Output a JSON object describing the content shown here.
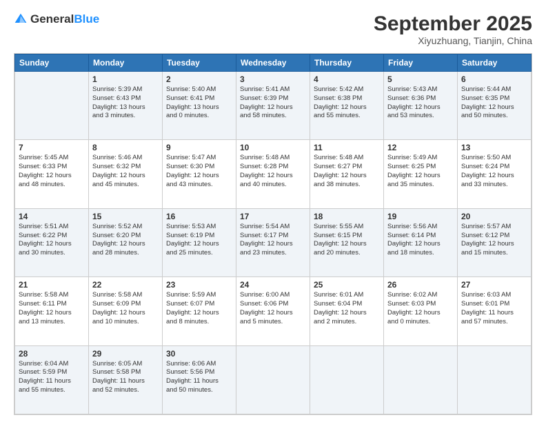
{
  "header": {
    "logo_general": "General",
    "logo_blue": "Blue",
    "month_title": "September 2025",
    "location": "Xiyuzhuang, Tianjin, China"
  },
  "weekdays": [
    "Sunday",
    "Monday",
    "Tuesday",
    "Wednesday",
    "Thursday",
    "Friday",
    "Saturday"
  ],
  "weeks": [
    [
      {
        "day": "",
        "info": ""
      },
      {
        "day": "1",
        "info": "Sunrise: 5:39 AM\nSunset: 6:43 PM\nDaylight: 13 hours\nand 3 minutes."
      },
      {
        "day": "2",
        "info": "Sunrise: 5:40 AM\nSunset: 6:41 PM\nDaylight: 13 hours\nand 0 minutes."
      },
      {
        "day": "3",
        "info": "Sunrise: 5:41 AM\nSunset: 6:39 PM\nDaylight: 12 hours\nand 58 minutes."
      },
      {
        "day": "4",
        "info": "Sunrise: 5:42 AM\nSunset: 6:38 PM\nDaylight: 12 hours\nand 55 minutes."
      },
      {
        "day": "5",
        "info": "Sunrise: 5:43 AM\nSunset: 6:36 PM\nDaylight: 12 hours\nand 53 minutes."
      },
      {
        "day": "6",
        "info": "Sunrise: 5:44 AM\nSunset: 6:35 PM\nDaylight: 12 hours\nand 50 minutes."
      }
    ],
    [
      {
        "day": "7",
        "info": "Sunrise: 5:45 AM\nSunset: 6:33 PM\nDaylight: 12 hours\nand 48 minutes."
      },
      {
        "day": "8",
        "info": "Sunrise: 5:46 AM\nSunset: 6:32 PM\nDaylight: 12 hours\nand 45 minutes."
      },
      {
        "day": "9",
        "info": "Sunrise: 5:47 AM\nSunset: 6:30 PM\nDaylight: 12 hours\nand 43 minutes."
      },
      {
        "day": "10",
        "info": "Sunrise: 5:48 AM\nSunset: 6:28 PM\nDaylight: 12 hours\nand 40 minutes."
      },
      {
        "day": "11",
        "info": "Sunrise: 5:48 AM\nSunset: 6:27 PM\nDaylight: 12 hours\nand 38 minutes."
      },
      {
        "day": "12",
        "info": "Sunrise: 5:49 AM\nSunset: 6:25 PM\nDaylight: 12 hours\nand 35 minutes."
      },
      {
        "day": "13",
        "info": "Sunrise: 5:50 AM\nSunset: 6:24 PM\nDaylight: 12 hours\nand 33 minutes."
      }
    ],
    [
      {
        "day": "14",
        "info": "Sunrise: 5:51 AM\nSunset: 6:22 PM\nDaylight: 12 hours\nand 30 minutes."
      },
      {
        "day": "15",
        "info": "Sunrise: 5:52 AM\nSunset: 6:20 PM\nDaylight: 12 hours\nand 28 minutes."
      },
      {
        "day": "16",
        "info": "Sunrise: 5:53 AM\nSunset: 6:19 PM\nDaylight: 12 hours\nand 25 minutes."
      },
      {
        "day": "17",
        "info": "Sunrise: 5:54 AM\nSunset: 6:17 PM\nDaylight: 12 hours\nand 23 minutes."
      },
      {
        "day": "18",
        "info": "Sunrise: 5:55 AM\nSunset: 6:15 PM\nDaylight: 12 hours\nand 20 minutes."
      },
      {
        "day": "19",
        "info": "Sunrise: 5:56 AM\nSunset: 6:14 PM\nDaylight: 12 hours\nand 18 minutes."
      },
      {
        "day": "20",
        "info": "Sunrise: 5:57 AM\nSunset: 6:12 PM\nDaylight: 12 hours\nand 15 minutes."
      }
    ],
    [
      {
        "day": "21",
        "info": "Sunrise: 5:58 AM\nSunset: 6:11 PM\nDaylight: 12 hours\nand 13 minutes."
      },
      {
        "day": "22",
        "info": "Sunrise: 5:58 AM\nSunset: 6:09 PM\nDaylight: 12 hours\nand 10 minutes."
      },
      {
        "day": "23",
        "info": "Sunrise: 5:59 AM\nSunset: 6:07 PM\nDaylight: 12 hours\nand 8 minutes."
      },
      {
        "day": "24",
        "info": "Sunrise: 6:00 AM\nSunset: 6:06 PM\nDaylight: 12 hours\nand 5 minutes."
      },
      {
        "day": "25",
        "info": "Sunrise: 6:01 AM\nSunset: 6:04 PM\nDaylight: 12 hours\nand 2 minutes."
      },
      {
        "day": "26",
        "info": "Sunrise: 6:02 AM\nSunset: 6:03 PM\nDaylight: 12 hours\nand 0 minutes."
      },
      {
        "day": "27",
        "info": "Sunrise: 6:03 AM\nSunset: 6:01 PM\nDaylight: 11 hours\nand 57 minutes."
      }
    ],
    [
      {
        "day": "28",
        "info": "Sunrise: 6:04 AM\nSunset: 5:59 PM\nDaylight: 11 hours\nand 55 minutes."
      },
      {
        "day": "29",
        "info": "Sunrise: 6:05 AM\nSunset: 5:58 PM\nDaylight: 11 hours\nand 52 minutes."
      },
      {
        "day": "30",
        "info": "Sunrise: 6:06 AM\nSunset: 5:56 PM\nDaylight: 11 hours\nand 50 minutes."
      },
      {
        "day": "",
        "info": ""
      },
      {
        "day": "",
        "info": ""
      },
      {
        "day": "",
        "info": ""
      },
      {
        "day": "",
        "info": ""
      }
    ]
  ]
}
